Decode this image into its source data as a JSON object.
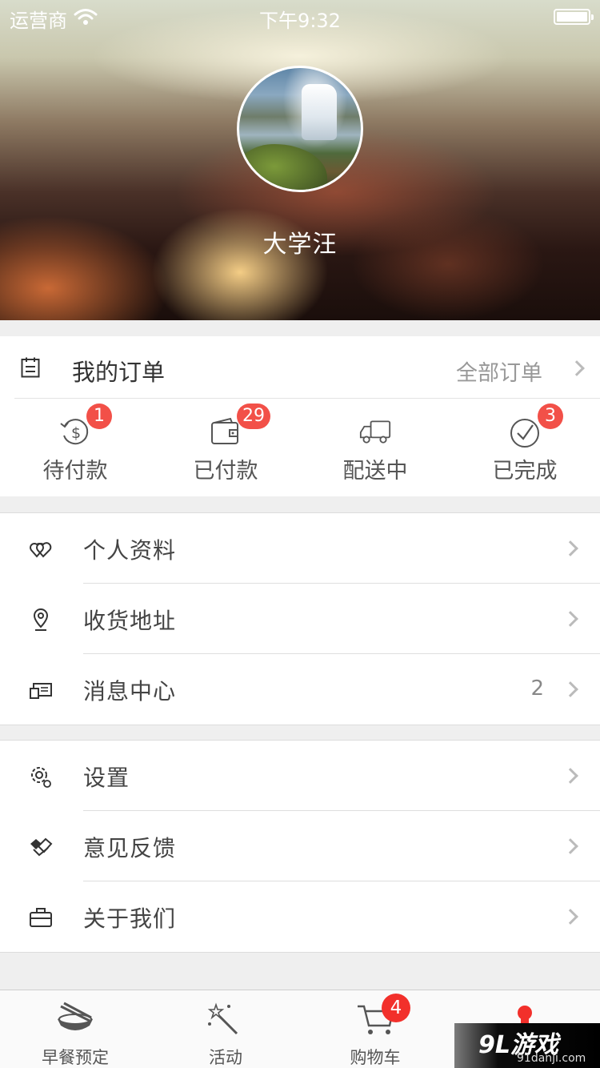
{
  "status_bar": {
    "carrier": "运营商",
    "time": "下午9:32"
  },
  "profile": {
    "name": "大学汪"
  },
  "orders": {
    "title": "我的订单",
    "all_label": "全部订单",
    "statuses": [
      {
        "label": "待付款",
        "badge": "1",
        "icon": "payment-pending-icon"
      },
      {
        "label": "已付款",
        "badge": "29",
        "icon": "wallet-icon"
      },
      {
        "label": "配送中",
        "badge": "",
        "icon": "truck-icon"
      },
      {
        "label": "已完成",
        "badge": "3",
        "icon": "check-circle-icon"
      }
    ]
  },
  "menu": {
    "group1": [
      {
        "label": "个人资料",
        "value": "",
        "icon": "hearts-icon"
      },
      {
        "label": "收货地址",
        "value": "",
        "icon": "location-pin-icon"
      },
      {
        "label": "消息中心",
        "value": "2",
        "icon": "message-card-icon"
      }
    ],
    "group2": [
      {
        "label": "设置",
        "value": "",
        "icon": "gear-icon"
      },
      {
        "label": "意见反馈",
        "value": "",
        "icon": "handshake-icon"
      },
      {
        "label": "关于我们",
        "value": "",
        "icon": "briefcase-icon"
      }
    ]
  },
  "tab_bar": {
    "tabs": [
      {
        "label": "早餐预定",
        "icon": "bowl-icon",
        "badge": ""
      },
      {
        "label": "活动",
        "icon": "magic-wand-icon",
        "badge": ""
      },
      {
        "label": "购物车",
        "icon": "cart-icon",
        "badge": "4"
      },
      {
        "label": "",
        "icon": "profile-icon",
        "badge": ""
      }
    ]
  },
  "watermark": {
    "main": "9L游戏",
    "sub": "91danji.com"
  },
  "colors": {
    "badge": "#f25048",
    "accent_red": "#f2302b",
    "background": "#efefef"
  }
}
